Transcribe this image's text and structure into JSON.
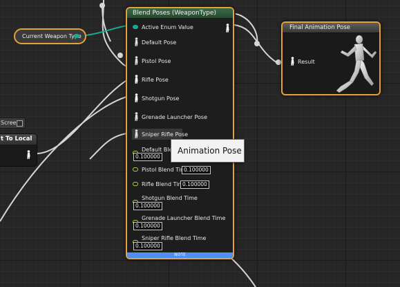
{
  "blend_node": {
    "title": "Blend Poses (WeaponType)",
    "active_enum_label": "Active Enum Value",
    "pose_pins": [
      {
        "label": "Default Pose"
      },
      {
        "label": "Pistol Pose"
      },
      {
        "label": "Rifle Pose"
      },
      {
        "label": "Shotgun Pose"
      },
      {
        "label": "Grenade Launcher Pose"
      },
      {
        "label": "Sniper Rifle Pose"
      }
    ],
    "blend_times": [
      {
        "label": "Default Blend Time",
        "value": "0.100000"
      },
      {
        "label": "Pistol Blend Time",
        "value": "0.100000"
      },
      {
        "label": "Rifle Blend Time",
        "value": "0.100000"
      },
      {
        "label": "Shotgun Blend Time",
        "value": "0.100000"
      },
      {
        "label": "Grenade Launcher Blend Time",
        "value": "0.100000"
      },
      {
        "label": "Sniper Rifle Blend Time",
        "value": "0.100000"
      }
    ],
    "note_label": "NOTE"
  },
  "final_node": {
    "title": "Final Animation Pose",
    "result_label": "Result"
  },
  "variable_node": {
    "label": "Current Weapon Type"
  },
  "left_nodes": {
    "screen_label": "Screen",
    "local_label": "t To Local"
  },
  "tooltip": {
    "text": "Animation Pose"
  },
  "colors": {
    "selection_border": "#e3a23a",
    "enum_pin": "#1aa890",
    "float_pin": "#a7d34b",
    "note": "#4f8ff0",
    "wire": "#d8d8d8"
  }
}
